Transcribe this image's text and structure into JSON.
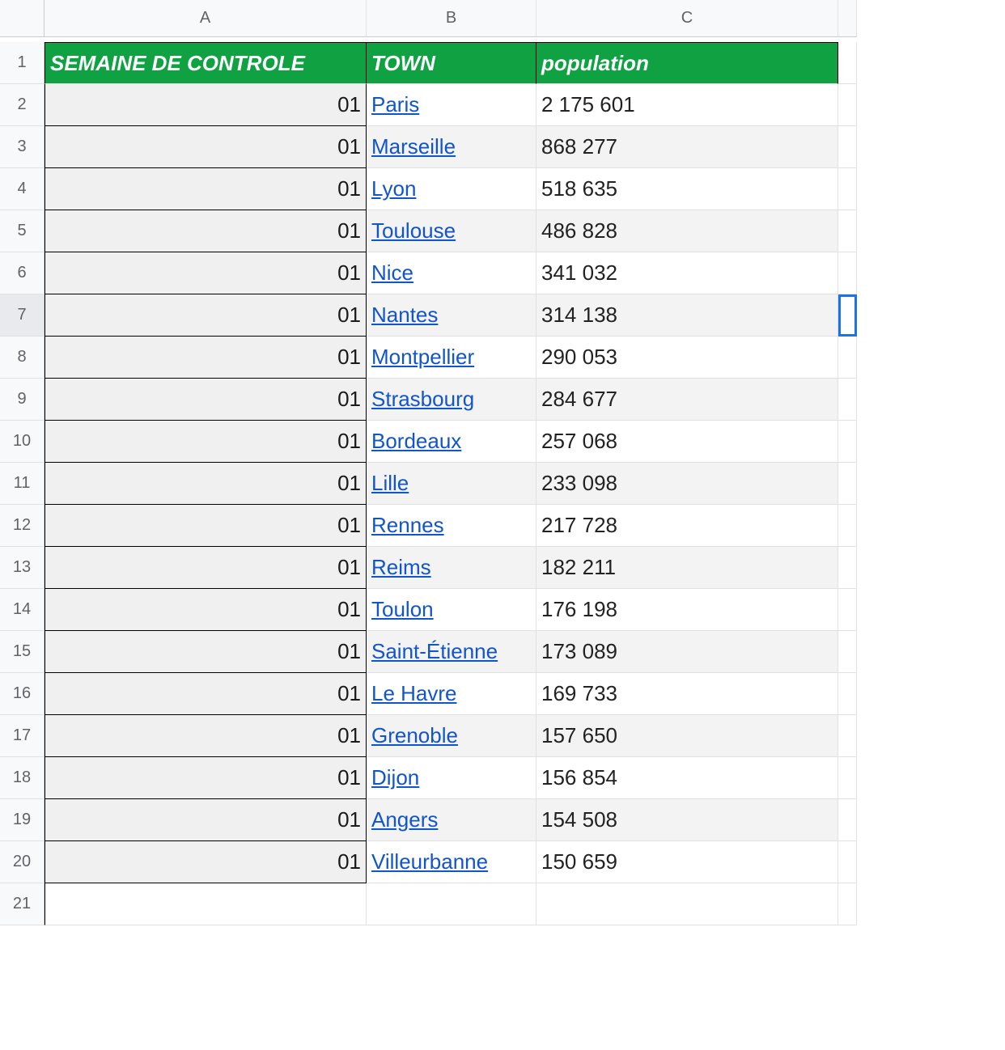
{
  "columns": [
    "A",
    "B",
    "C"
  ],
  "headers": {
    "a": "SEMAINE DE CONTROLE",
    "b": "TOWN",
    "c": "population"
  },
  "rows": [
    {
      "n": "2",
      "week": "01",
      "town": "Paris",
      "pop": "2 175 601"
    },
    {
      "n": "3",
      "week": "01",
      "town": "Marseille",
      "pop": "868 277"
    },
    {
      "n": "4",
      "week": "01",
      "town": "Lyon",
      "pop": "518 635"
    },
    {
      "n": "5",
      "week": "01",
      "town": "Toulouse",
      "pop": "486 828"
    },
    {
      "n": "6",
      "week": "01",
      "town": "Nice",
      "pop": "341 032"
    },
    {
      "n": "7",
      "week": "01",
      "town": "Nantes",
      "pop": "314 138"
    },
    {
      "n": "8",
      "week": "01",
      "town": "Montpellier",
      "pop": "290 053"
    },
    {
      "n": "9",
      "week": "01",
      "town": "Strasbourg",
      "pop": "284 677"
    },
    {
      "n": "10",
      "week": "01",
      "town": "Bordeaux",
      "pop": "257 068"
    },
    {
      "n": "11",
      "week": "01",
      "town": "Lille",
      "pop": "233 098"
    },
    {
      "n": "12",
      "week": "01",
      "town": "Rennes",
      "pop": "217 728"
    },
    {
      "n": "13",
      "week": "01",
      "town": "Reims",
      "pop": "182 211"
    },
    {
      "n": "14",
      "week": "01",
      "town": "Toulon",
      "pop": "176 198"
    },
    {
      "n": "15",
      "week": "01",
      "town": "Saint-Étienne",
      "pop": "173 089"
    },
    {
      "n": "16",
      "week": "01",
      "town": "Le Havre",
      "pop": "169 733"
    },
    {
      "n": "17",
      "week": "01",
      "town": "Grenoble",
      "pop": "157 650"
    },
    {
      "n": "18",
      "week": "01",
      "town": "Dijon",
      "pop": "156 854"
    },
    {
      "n": "19",
      "week": "01",
      "town": "Angers",
      "pop": "154 508"
    },
    {
      "n": "20",
      "week": "01",
      "town": "Villeurbanne",
      "pop": "150 659"
    }
  ],
  "emptyRow": "21",
  "selectedRow": "7"
}
